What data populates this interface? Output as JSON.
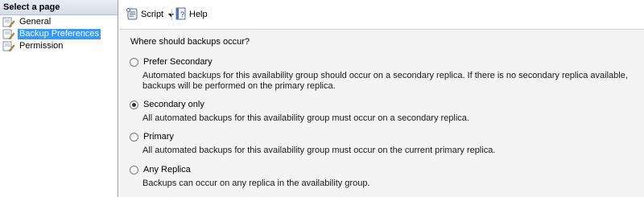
{
  "sidebar": {
    "header": "Select a page",
    "items": [
      {
        "label": "General",
        "selected": false
      },
      {
        "label": "Backup Preferences",
        "selected": true
      },
      {
        "label": "Permission",
        "selected": false
      }
    ]
  },
  "toolbar": {
    "script_label": "Script",
    "help_label": "Help"
  },
  "main": {
    "question": "Where should backups occur?",
    "options": [
      {
        "label": "Prefer Secondary",
        "checked": false,
        "description": "Automated backups for this availability group should occur on a secondary replica. If there is no secondary replica available, backups will be performed on the primary replica."
      },
      {
        "label": "Secondary only",
        "checked": true,
        "description": "All automated backups for this availability group must occur on a secondary replica."
      },
      {
        "label": "Primary",
        "checked": false,
        "description": "All automated backups for this availability group must occur on the current primary replica."
      },
      {
        "label": "Any Replica",
        "checked": false,
        "description": "Backups can occur on any replica in the availability group."
      }
    ]
  },
  "icons": {
    "page": "page-wrench-icon",
    "script": "script-icon",
    "dropdown": "chevron-down-icon",
    "help": "help-icon"
  }
}
